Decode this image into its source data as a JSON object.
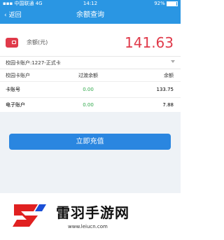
{
  "status_bar": {
    "carrier": "中国联通",
    "network": "4G",
    "time": "14:12",
    "battery": "92%",
    "battery_level": 0.92
  },
  "nav": {
    "back_label": "返回",
    "title": "余额查询"
  },
  "balance": {
    "label": "余额(元)",
    "value": "141.63"
  },
  "account_selector": {
    "value": "校园卡账户:1227-正式卡"
  },
  "table": {
    "headers": [
      "校园卡账户",
      "过渡余额",
      "余额"
    ],
    "rows": [
      [
        "卡账号",
        "0.00",
        "133.75"
      ],
      [
        "电子账户",
        "0.00",
        "7.88"
      ]
    ]
  },
  "actions": {
    "recharge_label": "立即充值"
  },
  "watermark": {
    "name": "雷羽手游网",
    "url": "www.leiucn.com"
  },
  "colors": {
    "primary": "#2a96e3",
    "button": "#2a86e0",
    "balance": "#e03a4a",
    "green": "#2fa84a"
  }
}
